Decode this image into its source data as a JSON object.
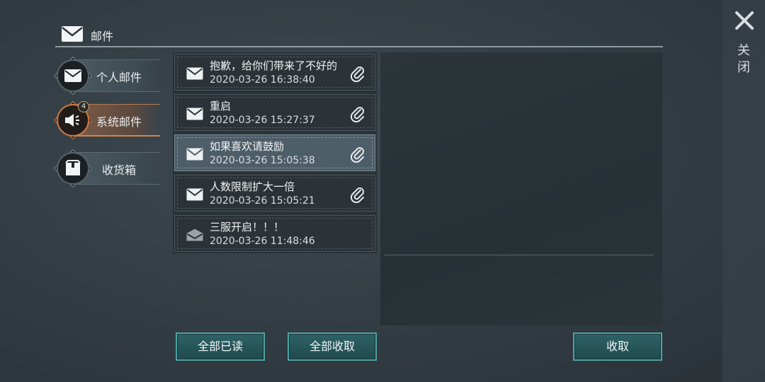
{
  "header": {
    "title": "邮件",
    "icon": "envelope-icon"
  },
  "tabs": [
    {
      "label": "个人邮件",
      "icon": "envelope-icon",
      "active": false
    },
    {
      "label": "系统邮件",
      "icon": "speaker-icon",
      "active": true,
      "count": "4"
    },
    {
      "label": "收货箱",
      "icon": "box-icon",
      "active": false
    }
  ],
  "mails": [
    {
      "title": "抱歉，给你们带来了不好的",
      "time": "2020-03-26 16:38:40",
      "read": false,
      "attachment": true
    },
    {
      "title": "重启",
      "time": "2020-03-26 15:27:37",
      "read": false,
      "attachment": true
    },
    {
      "title": "如果喜欢请鼓励",
      "time": "2020-03-26 15:05:38",
      "read": false,
      "attachment": true,
      "selected": true
    },
    {
      "title": "人数限制扩大一倍",
      "time": "2020-03-26 15:05:21",
      "read": false,
      "attachment": true
    },
    {
      "title": "三服开启！！！",
      "time": "2020-03-26 11:48:46",
      "read": true,
      "attachment": false
    }
  ],
  "buttons": {
    "mark_all_read": "全部已读",
    "collect_all": "全部收取",
    "collect": "收取"
  },
  "close": {
    "label": "关闭"
  },
  "colors": {
    "accent_active": "#d8824c",
    "button_border": "#4fa3a4"
  }
}
